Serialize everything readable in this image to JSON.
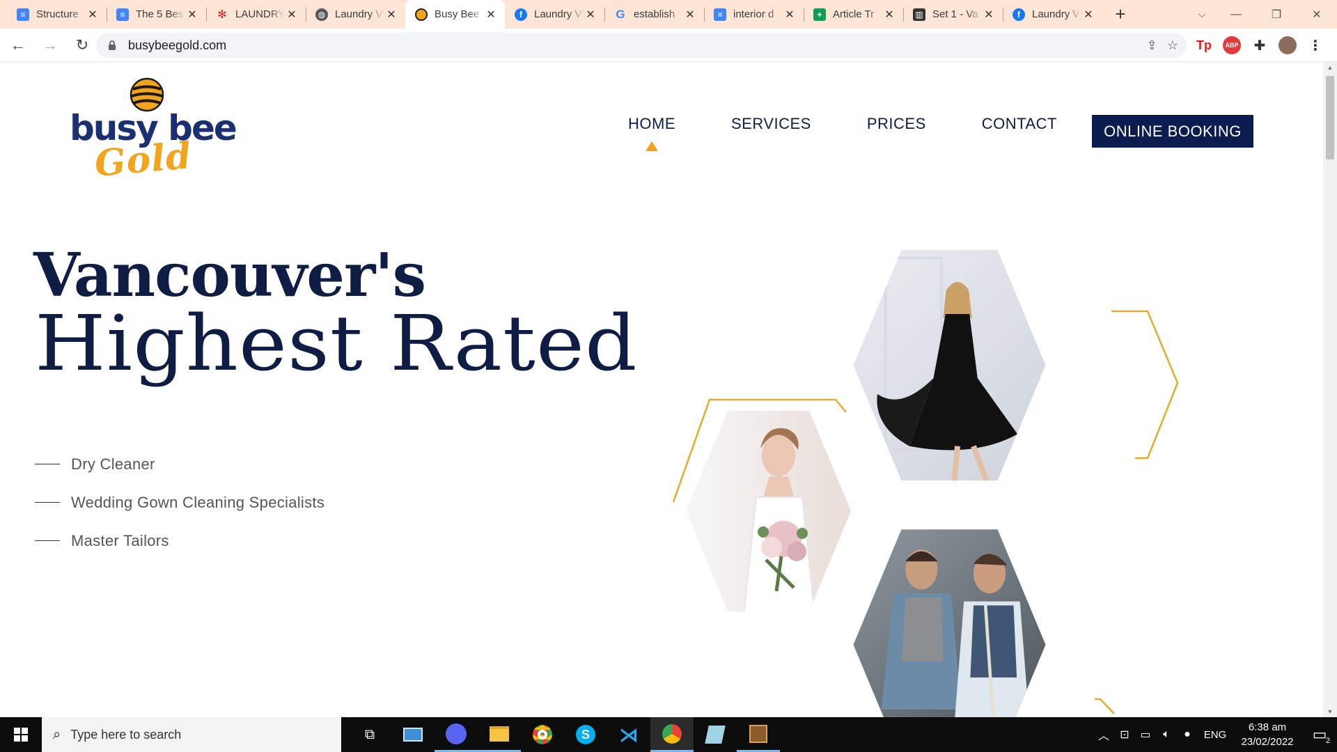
{
  "browser": {
    "tabs": [
      {
        "title": "Structure",
        "icon": "google-docs-icon",
        "active": false
      },
      {
        "title": "The 5 Bes",
        "icon": "google-docs-icon",
        "active": false
      },
      {
        "title": "LAUNDRY",
        "icon": "yelp-icon",
        "active": false
      },
      {
        "title": "Laundry V",
        "icon": "globe-icon",
        "active": false
      },
      {
        "title": "Busy Bee",
        "icon": "busybee-icon",
        "active": true
      },
      {
        "title": "Laundry V",
        "icon": "facebook-icon",
        "active": false
      },
      {
        "title": "establish",
        "icon": "google-icon",
        "active": false
      },
      {
        "title": "interior d",
        "icon": "google-docs-icon",
        "active": false
      },
      {
        "title": "Article Tr",
        "icon": "google-sheets-icon",
        "active": false
      },
      {
        "title": "Set 1 - Va",
        "icon": "book-icon",
        "active": false
      },
      {
        "title": "Laundry V",
        "icon": "facebook-icon",
        "active": false
      }
    ],
    "url": "busybeegold.com",
    "colors": {
      "tab_strip": "#fde5d6",
      "accent": "#0b1d4f",
      "gold": "#f0a11a"
    }
  },
  "site": {
    "logo": {
      "line1": "busy bee",
      "line2": "Gold"
    },
    "nav": {
      "home": "HOME",
      "services": "SERVICES",
      "prices": "PRICES",
      "contact": "CONTACT",
      "booking": "ONLINE BOOKING"
    },
    "hero": {
      "title": "Vancouver's",
      "subtitle": "Highest Rated",
      "features": [
        "Dry Cleaner",
        "Wedding Gown Cleaning Specialists",
        "Master Tailors"
      ]
    },
    "images": [
      "woman-black-dress-photo",
      "bride-bouquet-photo",
      "tailor-fitting-photo"
    ]
  },
  "taskbar": {
    "search_placeholder": "Type here to search",
    "language": "ENG",
    "time": "6:38 am",
    "date": "23/02/2022",
    "notifications": "2"
  }
}
